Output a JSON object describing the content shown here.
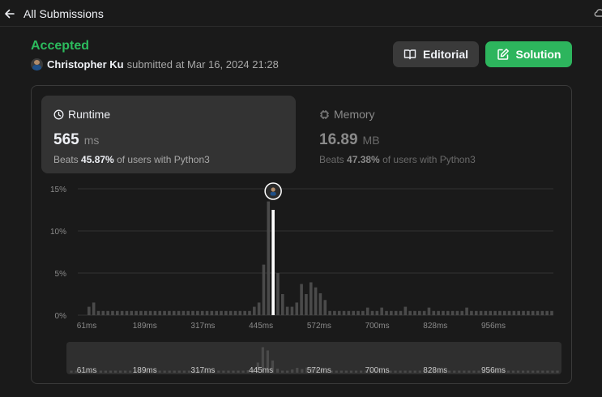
{
  "header": {
    "back_label": "All Submissions"
  },
  "submission": {
    "status": "Accepted",
    "username": "Christopher Ku",
    "submitted_text": "submitted at Mar 16, 2024 21:28"
  },
  "buttons": {
    "editorial": "Editorial",
    "solution": "Solution"
  },
  "runtime": {
    "label": "Runtime",
    "value": "565",
    "unit": "ms",
    "beats_prefix": "Beats",
    "beats_pct": "45.87%",
    "beats_suffix": "of users with Python3"
  },
  "memory": {
    "label": "Memory",
    "value": "16.89",
    "unit": "MB",
    "beats_prefix": "Beats",
    "beats_pct": "47.38%",
    "beats_suffix": "of users with Python3"
  },
  "colors": {
    "accent_green": "#2cbb5d",
    "button_green": "#2db55d",
    "bar_gray": "#4a4a4a",
    "highlight": "#ffffff",
    "background": "#1a1a1a"
  },
  "chart_data": {
    "type": "bar",
    "title": "",
    "xlabel": "",
    "ylabel": "",
    "x_tick_labels": [
      "61ms",
      "189ms",
      "317ms",
      "445ms",
      "572ms",
      "700ms",
      "828ms",
      "956ms"
    ],
    "y_tick_labels": [
      "0%",
      "5%",
      "10%",
      "15%"
    ],
    "ylim": [
      0,
      15
    ],
    "grid": true,
    "highlighted_bin_index": 40,
    "values": [
      0,
      1.0,
      1.5,
      0.5,
      0.5,
      0.5,
      0.5,
      0.5,
      0.5,
      0.5,
      0.5,
      0.5,
      0.5,
      0.5,
      0.5,
      0.5,
      0.5,
      0.5,
      0.5,
      0.5,
      0.5,
      0.5,
      0.5,
      0.5,
      0.5,
      0.5,
      0.5,
      0.5,
      0.5,
      0.5,
      0.5,
      0.5,
      0.5,
      0.5,
      0.5,
      0.5,
      1.0,
      1.5,
      6.0,
      13.5,
      12.5,
      5.0,
      2.5,
      1.0,
      1.0,
      1.5,
      3.7,
      2.5,
      3.9,
      3.3,
      2.6,
      1.8,
      0.5,
      0.5,
      0.5,
      0.5,
      0.5,
      0.5,
      0.5,
      0.5,
      0.9,
      0.5,
      0.5,
      0.9,
      0.5,
      0.5,
      0.5,
      0.5,
      1.0,
      0.5,
      0.5,
      0.5,
      0.5,
      0.9,
      0.5,
      0.5,
      0.5,
      0.5,
      0.5,
      0.5,
      0.5,
      0.9,
      0.5,
      0.5,
      0.5,
      0.5,
      0.5,
      0.5,
      0.5,
      0.5,
      0.5,
      0.5,
      0.5,
      0.5,
      0.5,
      0.5,
      0.5,
      0.5,
      0.5,
      0.5
    ],
    "overview_values": [
      0.5,
      0.5,
      0.5,
      0.5,
      0.5,
      0.5,
      0.5,
      0.5,
      0.5,
      0.5,
      0.5,
      0.5,
      0.5,
      0.5,
      0.5,
      0.5,
      0.5,
      0.5,
      0.5,
      0.5,
      0.5,
      0.5,
      0.5,
      0.5,
      0.5,
      0.5,
      0.5,
      0.5,
      0.5,
      0.5,
      0.5,
      0.5,
      0.5,
      0.5,
      0.5,
      0.5,
      0.6,
      0.9,
      2.5,
      6.3,
      5.5,
      3.0,
      1.0,
      0.5,
      0.5,
      0.8,
      1.2,
      0.9,
      1.3,
      1.2,
      1.0,
      0.8,
      0.5,
      0.5,
      0.5,
      0.5,
      0.5,
      0.5,
      0.5,
      0.5,
      0.5,
      0.5,
      0.5,
      0.5,
      0.5,
      0.5,
      0.5,
      0.5,
      0.5,
      0.5,
      0.5,
      0.5,
      0.5,
      0.5,
      0.5,
      0.5,
      0.5,
      0.5,
      0.5,
      0.5,
      0.5,
      0.5,
      0.5,
      0.5,
      0.5,
      0.5,
      0.5,
      0.5,
      0.5,
      0.5,
      0.5,
      0.5,
      0.5,
      0.5,
      0.5,
      0.5,
      0.5,
      0.5,
      0.5,
      0.5
    ]
  }
}
